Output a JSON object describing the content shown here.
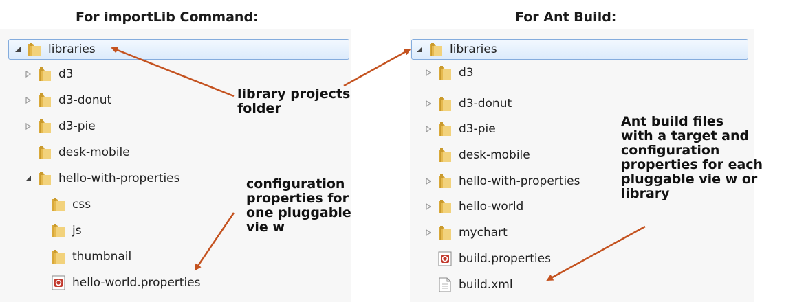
{
  "left": {
    "heading": "For importLib Command:",
    "rows": [
      {
        "label": "libraries",
        "toggle": "expanded",
        "icon": "folder",
        "selected": true
      },
      {
        "label": "d3",
        "toggle": "collapsed",
        "icon": "folder"
      },
      {
        "label": "d3-donut",
        "toggle": "collapsed",
        "icon": "folder"
      },
      {
        "label": "d3-pie",
        "toggle": "collapsed",
        "icon": "folder"
      },
      {
        "label": "desk-mobile",
        "toggle": "none",
        "icon": "folder"
      },
      {
        "label": "hello-with-properties",
        "toggle": "expanded",
        "icon": "folder"
      },
      {
        "label": "css",
        "toggle": "none",
        "icon": "folder"
      },
      {
        "label": "js",
        "toggle": "none",
        "icon": "folder"
      },
      {
        "label": "thumbnail",
        "toggle": "none",
        "icon": "folder"
      },
      {
        "label": "hello-world.properties",
        "toggle": "none",
        "icon": "properties-file-icon"
      }
    ]
  },
  "right": {
    "heading": "For Ant Build:",
    "rows": [
      {
        "label": "libraries",
        "toggle": "expanded",
        "icon": "folder",
        "selected": true
      },
      {
        "label": "d3",
        "toggle": "collapsed",
        "icon": "folder"
      },
      {
        "label": "d3-donut",
        "toggle": "collapsed",
        "icon": "folder"
      },
      {
        "label": "d3-pie",
        "toggle": "collapsed",
        "icon": "folder"
      },
      {
        "label": "desk-mobile",
        "toggle": "none",
        "icon": "folder"
      },
      {
        "label": "hello-with-properties",
        "toggle": "collapsed",
        "icon": "folder"
      },
      {
        "label": "hello-world",
        "toggle": "collapsed",
        "icon": "folder"
      },
      {
        "label": "mychart",
        "toggle": "collapsed",
        "icon": "folder"
      },
      {
        "label": "build.properties",
        "toggle": "none",
        "icon": "properties-file-icon"
      },
      {
        "label": "build.xml",
        "toggle": "none",
        "icon": "xml-file-icon"
      }
    ]
  },
  "annotations": {
    "library_projects": "library projects\nfolder",
    "config_one_view": "configuration\nproperties for\none pluggable\nvie w",
    "ant_build_files": "Ant build files\nwith a target and\nconfiguration\nproperties for each\npluggable vie w or\nlibrary"
  },
  "colors": {
    "arrow": "#c4521f",
    "folder": "#e9c25a",
    "selection_border": "#84acdd"
  }
}
